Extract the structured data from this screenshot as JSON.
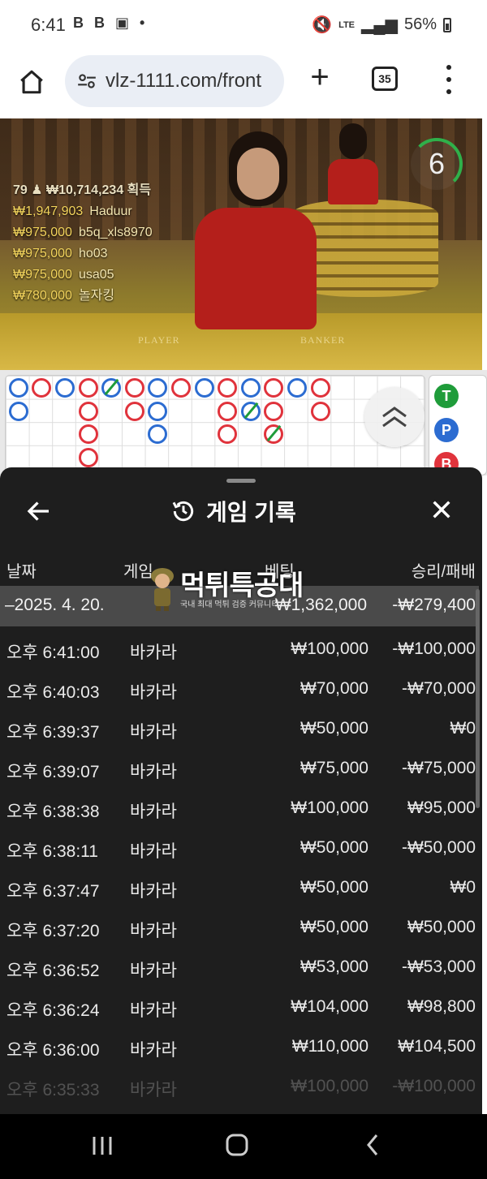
{
  "status_bar": {
    "time": "6:41",
    "left_icons": "B B ▣ •",
    "network": "LTE",
    "battery": "56%"
  },
  "browser": {
    "url": "vlz-1111.com/front",
    "tab_count": "35"
  },
  "game": {
    "timer": "6",
    "winners_header": "79 ♟ ₩10,714,234 획득",
    "winners": [
      {
        "amount": "₩1,947,903",
        "name": "Haduur"
      },
      {
        "amount": "₩975,000",
        "name": "b5q_xls8970"
      },
      {
        "amount": "₩975,000",
        "name": "ho03"
      },
      {
        "amount": "₩975,000",
        "name": "usa05"
      },
      {
        "amount": "₩780,000",
        "name": "놀자킹"
      }
    ],
    "table_labels": {
      "player": "PLAYER",
      "banker": "BANKER"
    },
    "side_buttons": [
      "T",
      "P",
      "B"
    ]
  },
  "sheet": {
    "title": "게임 기록",
    "columns": {
      "date": "날짜",
      "game": "게임",
      "bet": "베팅",
      "result": "승리/패배"
    },
    "summary": {
      "date": "–2025. 4. 20.",
      "bet": "₩1,362,000",
      "result": "-₩279,400"
    },
    "rows": [
      {
        "time": "오후 6:41:00",
        "game": "바카라",
        "bet": "₩100,000",
        "result": "-₩100,000"
      },
      {
        "time": "오후 6:40:03",
        "game": "바카라",
        "bet": "₩70,000",
        "result": "-₩70,000"
      },
      {
        "time": "오후 6:39:37",
        "game": "바카라",
        "bet": "₩50,000",
        "result": "₩0"
      },
      {
        "time": "오후 6:39:07",
        "game": "바카라",
        "bet": "₩75,000",
        "result": "-₩75,000"
      },
      {
        "time": "오후 6:38:38",
        "game": "바카라",
        "bet": "₩100,000",
        "result": "₩95,000"
      },
      {
        "time": "오후 6:38:11",
        "game": "바카라",
        "bet": "₩50,000",
        "result": "-₩50,000"
      },
      {
        "time": "오후 6:37:47",
        "game": "바카라",
        "bet": "₩50,000",
        "result": "₩0"
      },
      {
        "time": "오후 6:37:20",
        "game": "바카라",
        "bet": "₩50,000",
        "result": "₩50,000"
      },
      {
        "time": "오후 6:36:52",
        "game": "바카라",
        "bet": "₩53,000",
        "result": "-₩53,000"
      },
      {
        "time": "오후 6:36:24",
        "game": "바카라",
        "bet": "₩104,000",
        "result": "₩98,800"
      },
      {
        "time": "오후 6:36:00",
        "game": "바카라",
        "bet": "₩110,000",
        "result": "₩104,500"
      },
      {
        "time": "오후 6:35:33",
        "game": "바카라",
        "bet": "₩100,000",
        "result": "-₩100,000"
      }
    ]
  },
  "watermark": {
    "title_a": "먹튀",
    "title_b": "특공대",
    "subtitle": "국내 최대 먹튀 검증 커뮤니티"
  },
  "colors": {
    "banker": "#e0333c",
    "player": "#2c6cd1",
    "tie": "#1f9c3a",
    "sheet_bg": "#1e1e1e"
  }
}
